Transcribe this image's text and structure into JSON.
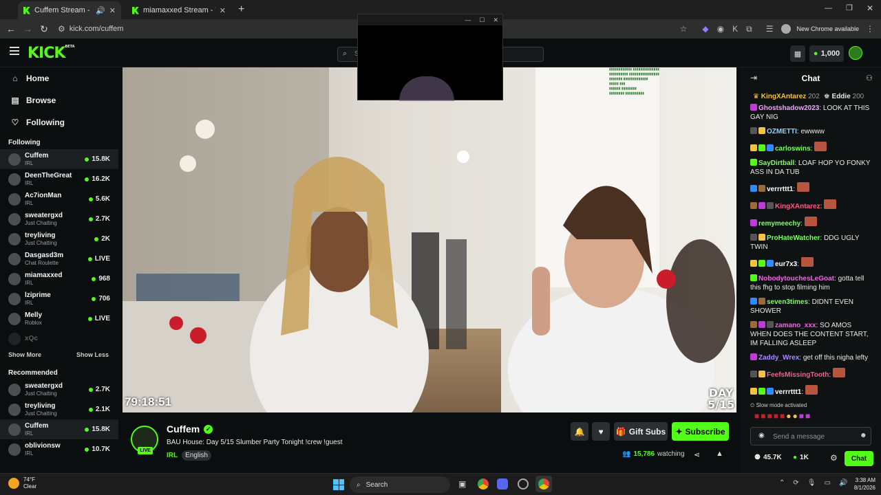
{
  "browser": {
    "tabs": [
      {
        "title": "Cuffem Stream - Watch Live",
        "active": true
      },
      {
        "title": "miamaxxed Stream - Watch Live",
        "active": false
      }
    ],
    "url": "kick.com/cuffem",
    "chrome_available": "New Chrome available"
  },
  "header": {
    "logo": "KICK",
    "logo_beta": "BETA",
    "search_placeholder": "S",
    "points": "1,000"
  },
  "sidebar": {
    "nav": [
      {
        "label": "Home",
        "icon": "home-icon"
      },
      {
        "label": "Browse",
        "icon": "browse-icon"
      },
      {
        "label": "Following",
        "icon": "heart-icon"
      }
    ],
    "following_title": "Following",
    "following": [
      {
        "name": "Cuffem",
        "category": "IRL",
        "viewers": "15.8K"
      },
      {
        "name": "DeenTheGreat",
        "category": "IRL",
        "viewers": "16.2K"
      },
      {
        "name": "Ac7ionMan",
        "category": "IRL",
        "viewers": "5.6K"
      },
      {
        "name": "sweatergxd",
        "category": "Just Chatting",
        "viewers": "2.7K"
      },
      {
        "name": "treyliving",
        "category": "Just Chatting",
        "viewers": "2K"
      },
      {
        "name": "Dasgasd3m",
        "category": "Chat Roulette",
        "viewers": "LIVE"
      },
      {
        "name": "miamaxxed",
        "category": "IRL",
        "viewers": "968"
      },
      {
        "name": "lziprime",
        "category": "IRL",
        "viewers": "706"
      },
      {
        "name": "Melly",
        "category": "Roblox",
        "viewers": "LIVE"
      },
      {
        "name": "xQc",
        "category": "",
        "viewers": ""
      }
    ],
    "show_more": "Show More",
    "show_less": "Show Less",
    "recommended_title": "Recommended",
    "recommended": [
      {
        "name": "sweatergxd",
        "category": "Just Chatting",
        "viewers": "2.7K"
      },
      {
        "name": "treyliving",
        "category": "Just Chatting",
        "viewers": "2.1K"
      },
      {
        "name": "Cuffem",
        "category": "IRL",
        "viewers": "15.8K"
      },
      {
        "name": "oblivionsw",
        "category": "IRL",
        "viewers": "10.7K"
      }
    ]
  },
  "video": {
    "uptime": "79:18:51",
    "day_label": "DAY",
    "day_value": "5/15"
  },
  "stream": {
    "name": "Cuffem",
    "title": "BAU House: Day 5/15 Slumber Party Tonight !crew !guest",
    "tags": [
      "IRL",
      "English"
    ],
    "live_badge": "LIVE",
    "watching": "15,786",
    "watching_label": "watching",
    "gift_subs": "Gift Subs",
    "subscribe": "Subscribe"
  },
  "chat": {
    "title": "Chat",
    "pinned": [
      {
        "user": "KingXAntarez",
        "count": "202"
      },
      {
        "user": "Eddie",
        "count": "200"
      }
    ],
    "messages": [
      {
        "user": "Ghostshadow2023",
        "text": "LOOK AT THIS GAY NIG",
        "color": "#f7a0ff"
      },
      {
        "user": "OZMETTI",
        "text": "ewwww",
        "color": "#8fd3ff"
      },
      {
        "user": "carloswins",
        "text": "",
        "color": "#7dff63"
      },
      {
        "user": "SayDirtball",
        "text": "LOAF HOP YO FONKY ASS IN DA TUB",
        "color": "#7dff63"
      },
      {
        "user": "verrrttt1",
        "text": "",
        "color": "#ffffff"
      },
      {
        "user": "KingXAntarez",
        "text": "",
        "color": "#ff5c8a"
      },
      {
        "user": "remymeechy",
        "text": "",
        "color": "#7dff63"
      },
      {
        "user": "ProHateWatcher",
        "text": "DDG UGLY TWIN",
        "color": "#7dff63"
      },
      {
        "user": "eur7x3",
        "text": "",
        "color": "#ffffff"
      },
      {
        "user": "NobodytouchesLeGoat",
        "text": "gotta tell this fhg to stop filming him",
        "color": "#ff5cf0"
      },
      {
        "user": "seven3times",
        "text": "DIDNT EVEN SHOWER",
        "color": "#7dff63"
      },
      {
        "user": "zamano_xxx",
        "text": "SO AMOS WHEN DOES THE CONTENT START, IM FALLING ASLEEP",
        "color": "#ff5cf0"
      },
      {
        "user": "Zaddy_Wrex",
        "text": "get off this nigha lefty",
        "color": "#a98bff"
      },
      {
        "user": "FeefsMissingTooth",
        "text": "",
        "color": "#ff5c8a"
      },
      {
        "user": "verrrttt1",
        "text": "",
        "color": "#ffffff"
      }
    ],
    "slow_mode": "Slow mode activated",
    "input_placeholder": "Send a message",
    "followers": "45.7K",
    "points": "1K",
    "send_label": "Chat"
  },
  "taskbar": {
    "weather_temp": "74°F",
    "weather_cond": "Clear",
    "search": "Search",
    "time": "3:38 AM",
    "date": "8/1/2026"
  }
}
